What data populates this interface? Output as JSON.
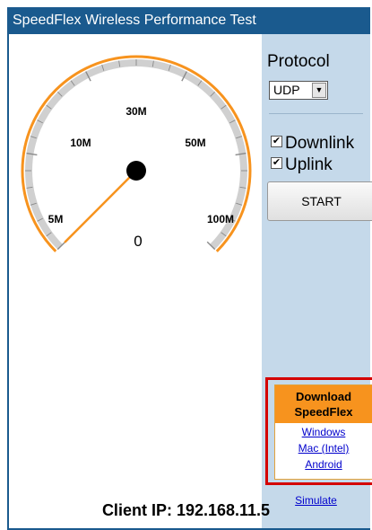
{
  "window": {
    "title": "SpeedFlex Wireless Performance Test"
  },
  "gauge": {
    "labels": [
      "5M",
      "10M",
      "30M",
      "50M",
      "100M"
    ],
    "reading": "0",
    "needle_value": 0,
    "colors": {
      "arc": "#f7931e",
      "track": "#d0d0d0",
      "needle": "#f7931e",
      "hub": "#000000"
    }
  },
  "side": {
    "protocol_label": "Protocol",
    "protocol_value": "UDP",
    "downlink_label": "Downlink",
    "downlink_checked": true,
    "uplink_label": "Uplink",
    "uplink_checked": true,
    "start_label": "START"
  },
  "download": {
    "header_line1": "Download",
    "header_line2": "SpeedFlex",
    "links": [
      "Windows",
      "Mac (Intel)",
      "Android"
    ]
  },
  "simulate_label": "Simulate",
  "client_ip": "Client IP: 192.168.11.5"
}
